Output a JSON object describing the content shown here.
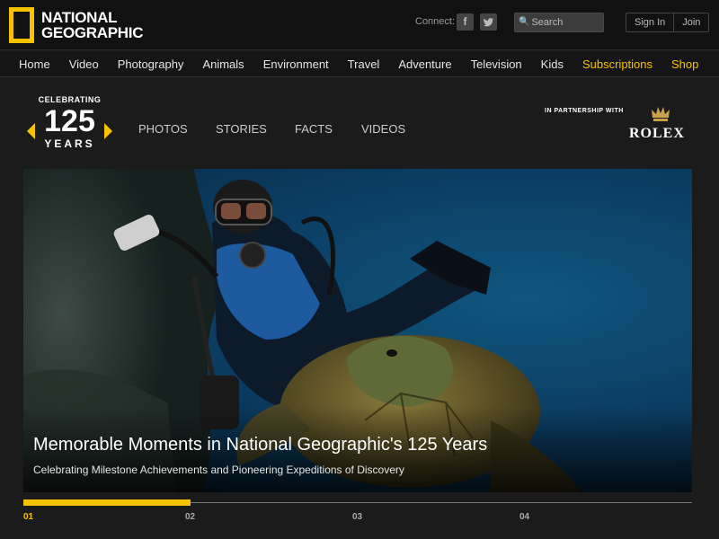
{
  "header": {
    "logo_line1": "NATIONAL",
    "logo_line2": "GEOGRAPHIC",
    "connect_label": "Connect:",
    "social": [
      {
        "icon": "facebook-icon",
        "glyph": "f"
      },
      {
        "icon": "twitter-icon",
        "glyph": "t"
      }
    ],
    "search_placeholder": "Search",
    "sign_in": "Sign In",
    "join": "Join"
  },
  "nav": {
    "items": [
      {
        "label": "Home"
      },
      {
        "label": "Video"
      },
      {
        "label": "Photography"
      },
      {
        "label": "Animals"
      },
      {
        "label": "Environment"
      },
      {
        "label": "Travel"
      },
      {
        "label": "Adventure"
      },
      {
        "label": "Television"
      },
      {
        "label": "Kids"
      },
      {
        "label": "Subscriptions",
        "highlight": true
      },
      {
        "label": "Shop",
        "highlight": true
      }
    ]
  },
  "celebration": {
    "line1": "CELEBRATING",
    "number": "125",
    "line3": "YEARS",
    "subnav": [
      "PHOTOS",
      "STORIES",
      "FACTS",
      "VIDEOS"
    ],
    "partner_text": "IN PARTNERSHIP WITH",
    "partner_name": "ROLEX"
  },
  "hero": {
    "title": "Memorable Moments in National Geographic's 125 Years",
    "subtitle": "Celebrating Milestone Achievements and Pioneering Expeditions of Discovery"
  },
  "slider": {
    "steps": [
      "01",
      "02",
      "03",
      "04"
    ],
    "active_index": 0,
    "progress": 0.25
  },
  "colors": {
    "accent": "#f7c300",
    "background": "#1b1b1b"
  }
}
